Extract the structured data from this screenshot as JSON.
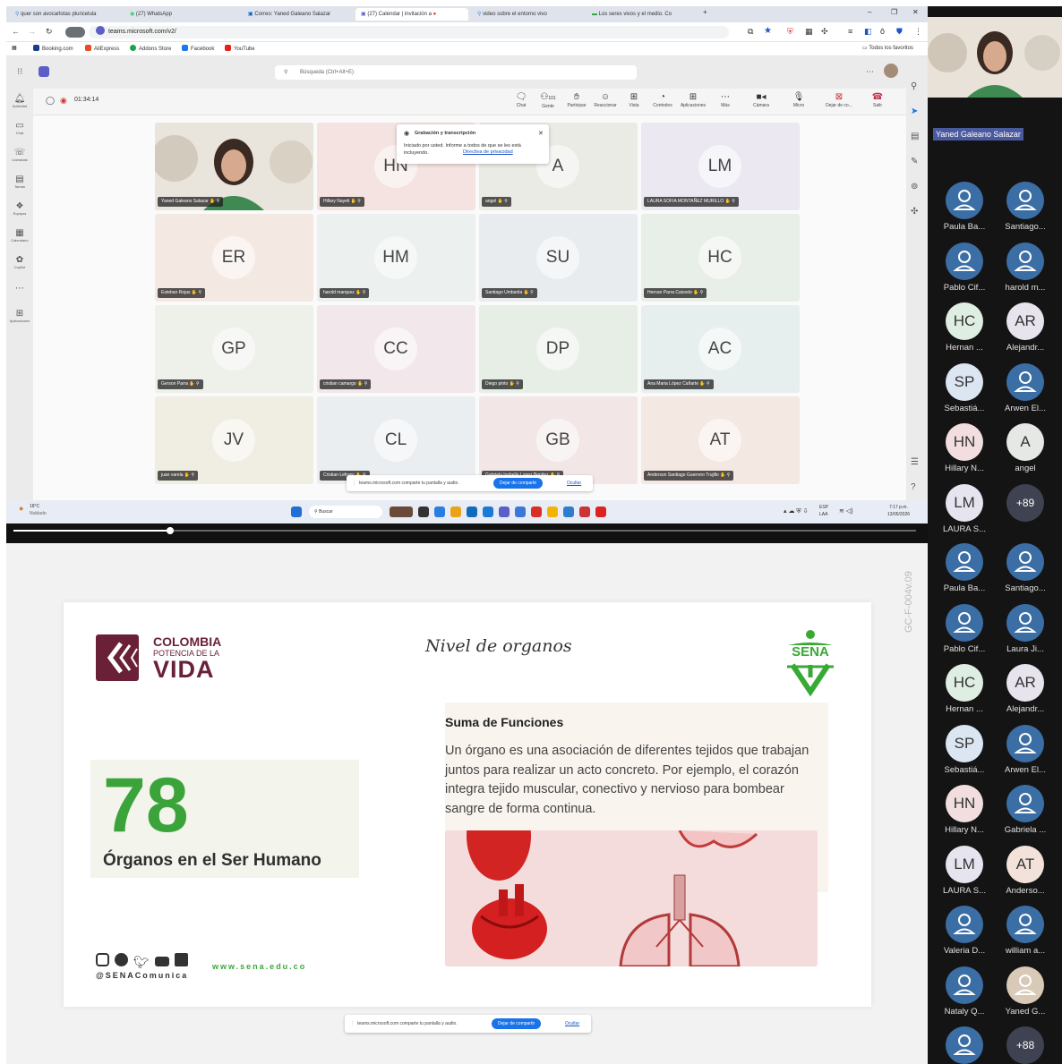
{
  "browser": {
    "tabs": [
      {
        "label": "quer son avocarlotas pluricelula",
        "active": false
      },
      {
        "label": "(27) WhatsApp",
        "active": false
      },
      {
        "label": "Correo: Yaned Galeano Salazar",
        "active": false
      },
      {
        "label": "(27) Calendar | invitación a",
        "active": true
      },
      {
        "label": "video sobre el entorno vivo",
        "active": false
      },
      {
        "label": "Los seres vivos y el medio. Co",
        "active": false
      }
    ],
    "url": "teams.microsoft.com/v2/",
    "bookmarks": [
      "Booking.com",
      "AliExpress",
      "Addons Store",
      "Facebook",
      "YouTube"
    ],
    "bookmarks_right": "Todos los favoritos"
  },
  "teams": {
    "search_placeholder": "Búsqueda (Ctrl+Alt+E)",
    "timer": "01:34:14",
    "participants_count": "101",
    "rail": [
      "Actividad",
      "Chat",
      "Llamadas",
      "Tareas",
      "Equipos",
      "Calendario",
      "Copilot",
      "Aplicaciones"
    ],
    "call_buttons": [
      "Chat",
      "Gente",
      "Participar",
      "Reaccionar",
      "Vista",
      "Controles",
      "Aplicaciones",
      "Más",
      "Cámara",
      "Micro",
      "Dejar de co...",
      "Salir"
    ],
    "tiles": [
      {
        "initials": "",
        "name": "Yaned Galeano Salazar",
        "bg": "#d8cfc2",
        "video": true
      },
      {
        "initials": "HN",
        "name": "Hillary Nayeli",
        "bg": "#f4e3e0"
      },
      {
        "initials": "A",
        "name": "angel",
        "bg": "#e9ebe4"
      },
      {
        "initials": "LM",
        "name": "LAURA SOFIA MONTAÑEZ MURILLO",
        "bg": "#ebe8f2"
      },
      {
        "initials": "ER",
        "name": "Esteban Rojas",
        "bg": "#f4e8e2"
      },
      {
        "initials": "HM",
        "name": "harold marquez",
        "bg": "#ecf0ee"
      },
      {
        "initials": "SU",
        "name": "Santiago Umbarila",
        "bg": "#e9ecef"
      },
      {
        "initials": "HC",
        "name": "Hernan Parra Caicedo",
        "bg": "#e8eee8"
      },
      {
        "initials": "GP",
        "name": "Gerson Parra",
        "bg": "#eef0ea"
      },
      {
        "initials": "CC",
        "name": "cristian camargo",
        "bg": "#f2e7ea"
      },
      {
        "initials": "DP",
        "name": "Diego pinto",
        "bg": "#e6eee6"
      },
      {
        "initials": "AC",
        "name": "Ana Maria López Cañarte",
        "bg": "#e6efee"
      },
      {
        "initials": "JV",
        "name": "juan varela",
        "bg": "#f0ede2"
      },
      {
        "initials": "CL",
        "name": "Cristian Lefranc",
        "bg": "#eaeef0"
      },
      {
        "initials": "GB",
        "name": "Gabriela Isabella Lopez Benitez",
        "bg": "#f2e6e6"
      },
      {
        "initials": "AT",
        "name": "Anderson Santiago Guerrero Trujillo",
        "bg": "#f3e8e2"
      }
    ],
    "recording_popup": {
      "title": "Grabación y transcripción",
      "body": "Iniciado por usted. Informe a todos de que se les está incluyendo.",
      "link": "Directiva de privacidad"
    }
  },
  "share_bar": {
    "text": "teams.microsoft.com comparte tu pantalla y audio.",
    "stop": "Dejar de compartir",
    "hide": "Ocultar"
  },
  "taskbar": {
    "weather_temp": "18°C",
    "weather_desc": "Nublado",
    "search": "Buscar",
    "lang1": "ESP",
    "lang2": "LAA",
    "time": "7:17 p.m.",
    "date": "13/05/2026"
  },
  "slide": {
    "logo_line1": "COLOMBIA",
    "logo_line2": "POTENCIA DE LA",
    "logo_line3": "VIDA",
    "title": "Nivel de organos",
    "sena": "SENA",
    "big_number": "78",
    "big_caption": "Órganos en el Ser Humano",
    "box_title": "Suma de Funciones",
    "box_body": "Un órgano es una asociación de diferentes tejidos que trabajan juntos para realizar un acto concreto. Por ejemplo, el corazón integra tejido muscular, conectivo y nervioso para bombear sangre de forma continua.",
    "social_handle": "@SENAComunica",
    "website": "www.sena.edu.co",
    "doc_code": "GC-F-004v.09"
  },
  "panel": {
    "self_name": "Yaned Galeano Salazar",
    "top_list": [
      {
        "initials": "",
        "name": "Paula Ba...",
        "color": "#3b6ea5"
      },
      {
        "initials": "",
        "name": "Santiago...",
        "color": "#3b6ea5"
      },
      {
        "initials": "",
        "name": "Pablo Cif...",
        "color": "#3b6ea5"
      },
      {
        "initials": "",
        "name": "harold m...",
        "color": "#3b6ea5"
      },
      {
        "initials": "HC",
        "name": "Hernan ...",
        "color": "#dfeee2"
      },
      {
        "initials": "AR",
        "name": "Alejandr...",
        "color": "#e7e4ee"
      },
      {
        "initials": "SP",
        "name": "Sebastiá...",
        "color": "#dce6f2"
      },
      {
        "initials": "",
        "name": "Arwen El...",
        "color": "#3b6ea5"
      },
      {
        "initials": "HN",
        "name": "Hillary N...",
        "color": "#f2dede"
      },
      {
        "initials": "A",
        "name": "angel",
        "color": "#e6e8e6"
      },
      {
        "initials": "LM",
        "name": "LAURA S...",
        "color": "#e6e4ef"
      },
      {
        "initials": "+89",
        "name": "",
        "color": "#3f4250"
      }
    ],
    "bottom_list": [
      {
        "initials": "",
        "name": "Paula Ba...",
        "color": "#3b6ea5"
      },
      {
        "initials": "",
        "name": "Santiago...",
        "color": "#3b6ea5"
      },
      {
        "initials": "",
        "name": "Pablo Cif...",
        "color": "#3b6ea5"
      },
      {
        "initials": "",
        "name": "Laura Ji...",
        "color": "#3b6ea5"
      },
      {
        "initials": "HC",
        "name": "Hernan ...",
        "color": "#dfeee2"
      },
      {
        "initials": "AR",
        "name": "Alejandr...",
        "color": "#e7e4ee"
      },
      {
        "initials": "SP",
        "name": "Sebastiá...",
        "color": "#dce6f2"
      },
      {
        "initials": "",
        "name": "Arwen El...",
        "color": "#3b6ea5"
      },
      {
        "initials": "HN",
        "name": "Hillary N...",
        "color": "#f2dede"
      },
      {
        "initials": "",
        "name": "Gabriela ...",
        "color": "#3b6ea5"
      },
      {
        "initials": "LM",
        "name": "LAURA S...",
        "color": "#e6e4ef"
      },
      {
        "initials": "AT",
        "name": "Anderso...",
        "color": "#f3e2da"
      },
      {
        "initials": "",
        "name": "Valeria D...",
        "color": "#3b6ea5"
      },
      {
        "initials": "",
        "name": "william a...",
        "color": "#3b6ea5"
      },
      {
        "initials": "",
        "name": "Nataly Q...",
        "color": "#3b6ea5"
      },
      {
        "initials": "",
        "name": "Yaned G...",
        "color": "#d9c9b7"
      },
      {
        "initials": "",
        "name": "",
        "color": "#3b6ea5"
      },
      {
        "initials": "+88",
        "name": "",
        "color": "#3f4250"
      }
    ]
  },
  "colors": {
    "teams_purple": "#5b5fc7",
    "sena_green": "#39a935",
    "big_number_green": "#3aa43b",
    "colombia_maroon": "#6a2137",
    "share_button": "#1a73e8"
  }
}
